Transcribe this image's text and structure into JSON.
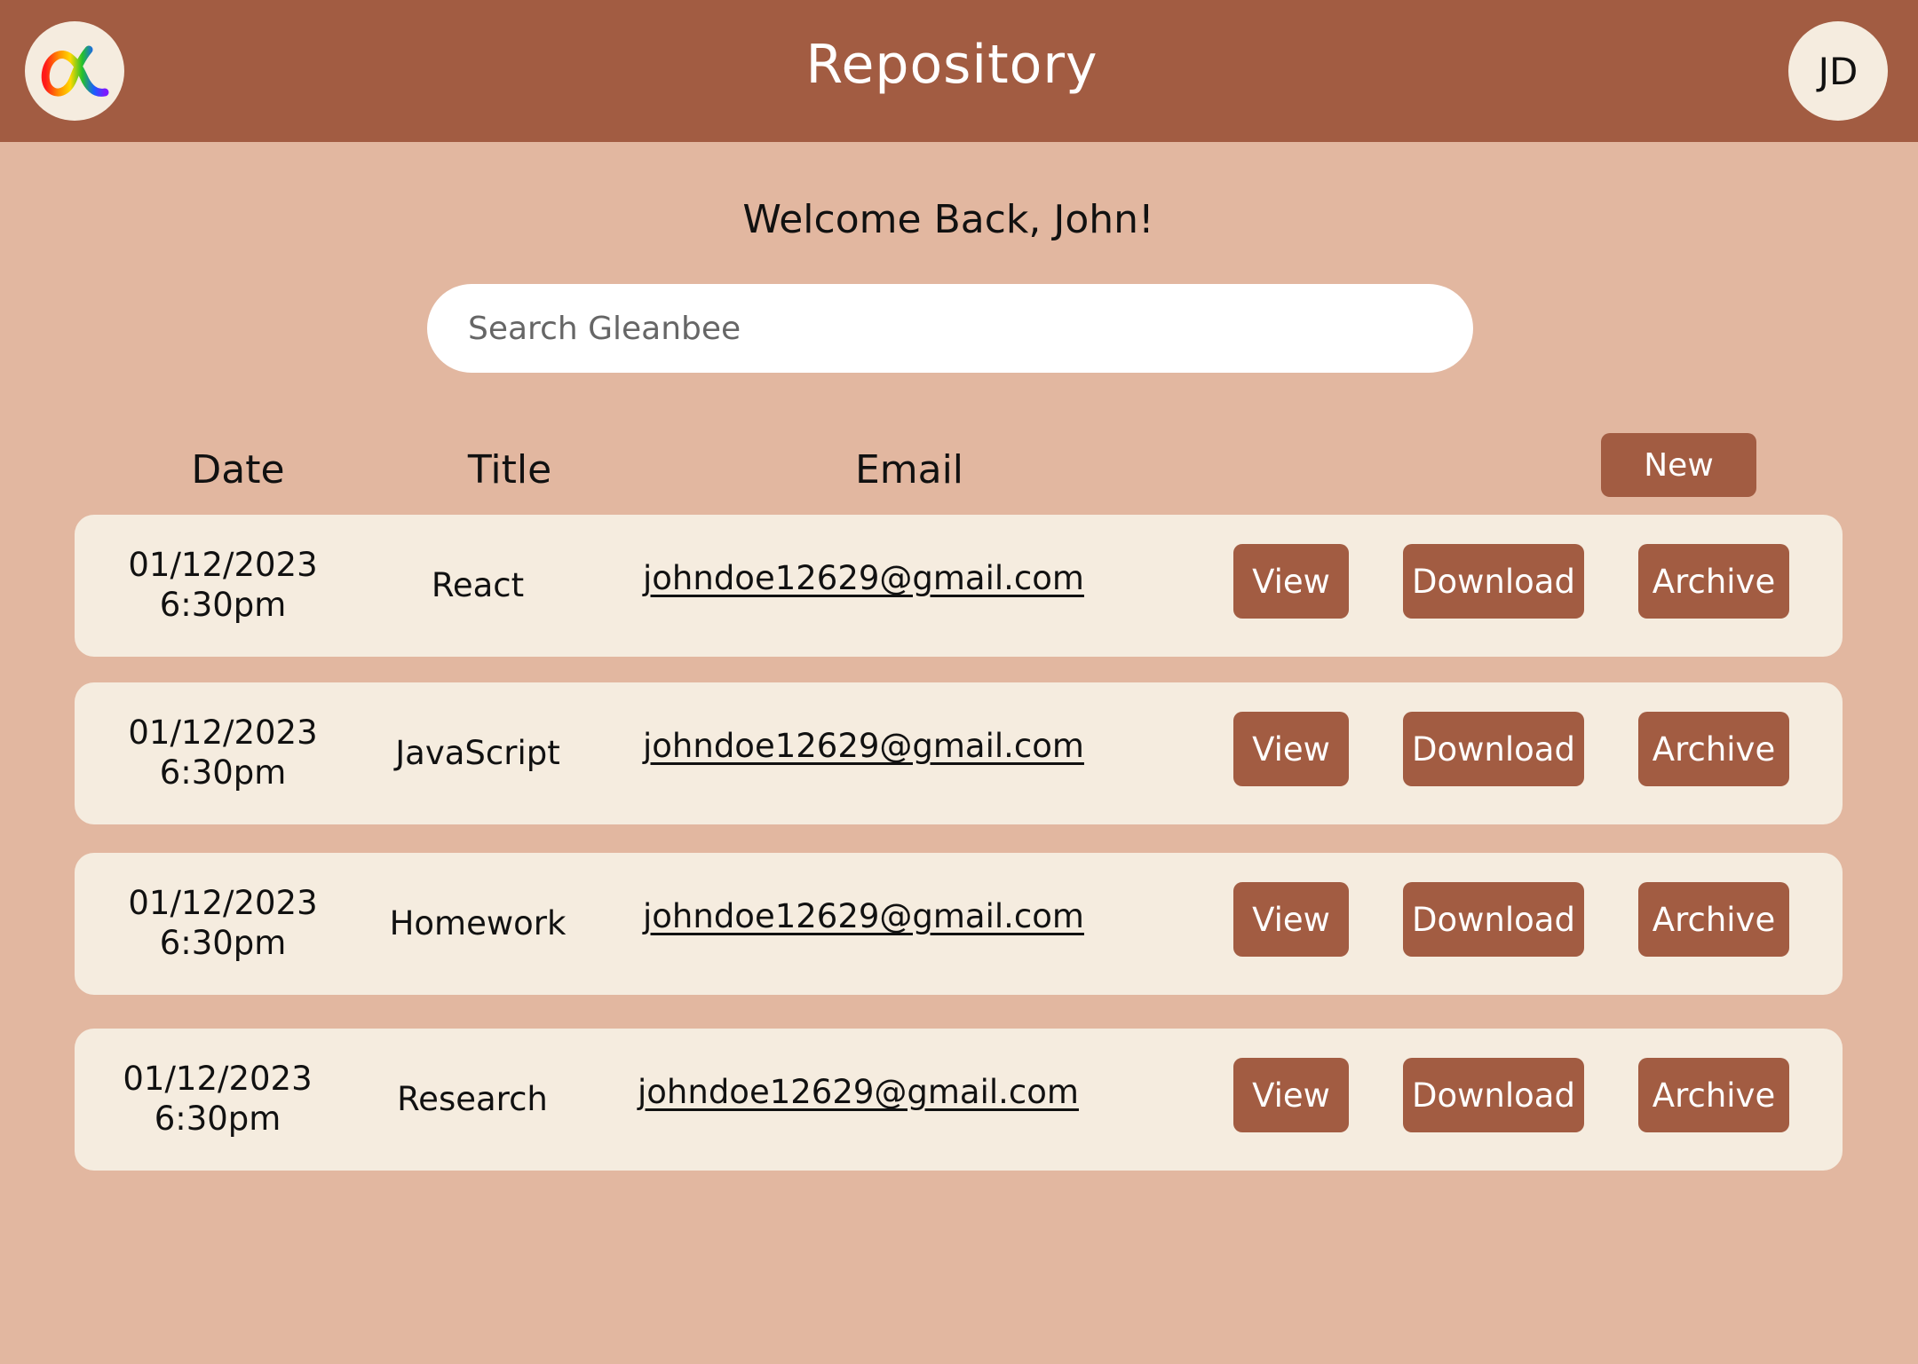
{
  "header": {
    "title": "Repository",
    "logo_icon": "rainbow-alpha-logo-icon",
    "avatar_initials": "JD"
  },
  "welcome": "Welcome Back, John!",
  "search": {
    "placeholder": "Search Gleanbee",
    "value": ""
  },
  "columns": {
    "date": "Date",
    "title": "Title",
    "email": "Email"
  },
  "new_label": "New",
  "actions": {
    "view": "View",
    "download": "Download",
    "archive": "Archive"
  },
  "rows": [
    {
      "date": "01/12/2023",
      "time": "6:30pm",
      "title": "React",
      "email": "johndoe12629@gmail.com"
    },
    {
      "date": "01/12/2023",
      "time": "6:30pm",
      "title": "JavaScript",
      "email": "johndoe12629@gmail.com"
    },
    {
      "date": "01/12/2023",
      "time": "6:30pm",
      "title": "Homework",
      "email": "johndoe12629@gmail.com"
    },
    {
      "date": "01/12/2023",
      "time": "6:30pm",
      "title": "Research",
      "email": "johndoe12629@gmail.com"
    }
  ],
  "colors": {
    "header_bg": "#a25c42",
    "page_bg": "#e2b7a0",
    "card_bg": "#f5ecdf",
    "button_bg": "#a25c42"
  }
}
